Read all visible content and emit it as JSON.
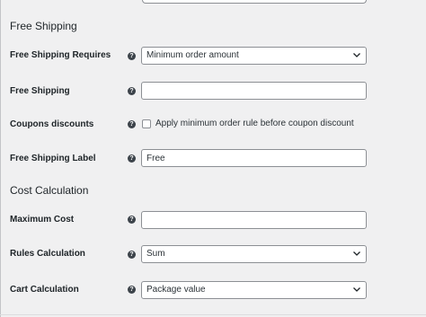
{
  "sections": {
    "free_shipping_title": "Free Shipping",
    "cost_calculation_title": "Cost Calculation"
  },
  "fields": {
    "free_shipping_requires": {
      "label": "Free Shipping Requires",
      "value": "Minimum order amount"
    },
    "free_shipping": {
      "label": "Free Shipping",
      "value": ""
    },
    "coupons_discounts": {
      "label": "Coupons discounts",
      "checkbox_label": "Apply minimum order rule before coupon discount",
      "checked": false
    },
    "free_shipping_label": {
      "label": "Free Shipping Label",
      "value": "Free"
    },
    "maximum_cost": {
      "label": "Maximum Cost",
      "value": ""
    },
    "rules_calculation": {
      "label": "Rules Calculation",
      "value": "Sum"
    },
    "cart_calculation": {
      "label": "Cart Calculation",
      "value": "Package value"
    }
  },
  "icons": {
    "help": "help-icon",
    "dropdown": "chevron-down-icon"
  },
  "colors": {
    "background": "#f0f0f1",
    "text": "#1d2327",
    "field_border": "#8c8f94",
    "help_icon": "#3c434a"
  }
}
